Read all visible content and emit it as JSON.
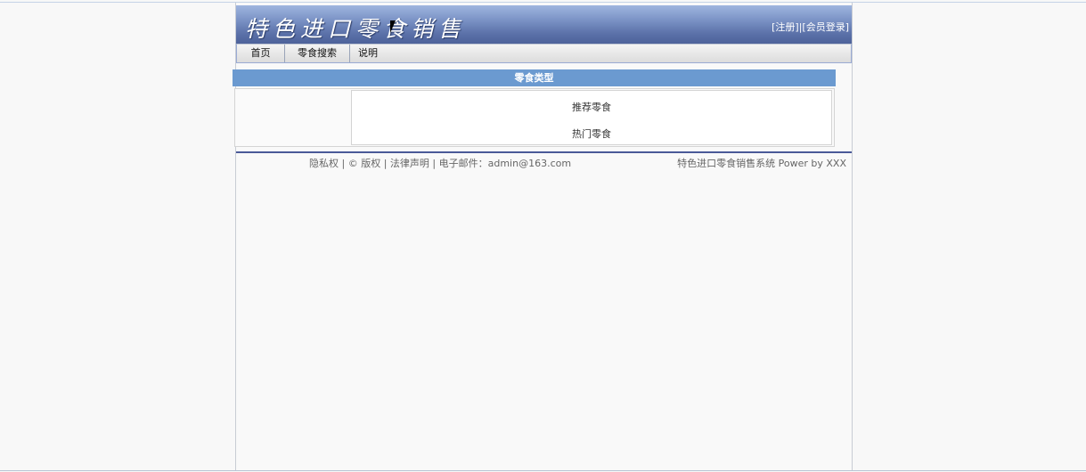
{
  "header": {
    "site_title": "特色进口零食销售",
    "register_label": "注册",
    "login_label": "会员登录"
  },
  "nav": {
    "items": [
      {
        "label": "首页"
      },
      {
        "label": "零食搜索"
      },
      {
        "label": "说明"
      }
    ]
  },
  "main": {
    "section_title": "零食类型",
    "categories": [
      {
        "label": "推荐零食"
      },
      {
        "label": "热门零食"
      }
    ]
  },
  "footer": {
    "privacy": "隐私权",
    "copyright": "© 版权",
    "legal": "法律声明",
    "email_label": "电子邮件：admin@163.com",
    "system_name": "特色进口零食销售系统",
    "powered_by": "Power by XXX"
  },
  "colors": {
    "header_bg": "#5a70a8",
    "section_bar": "#6b9ad0",
    "footer_line": "#4a5a98"
  }
}
